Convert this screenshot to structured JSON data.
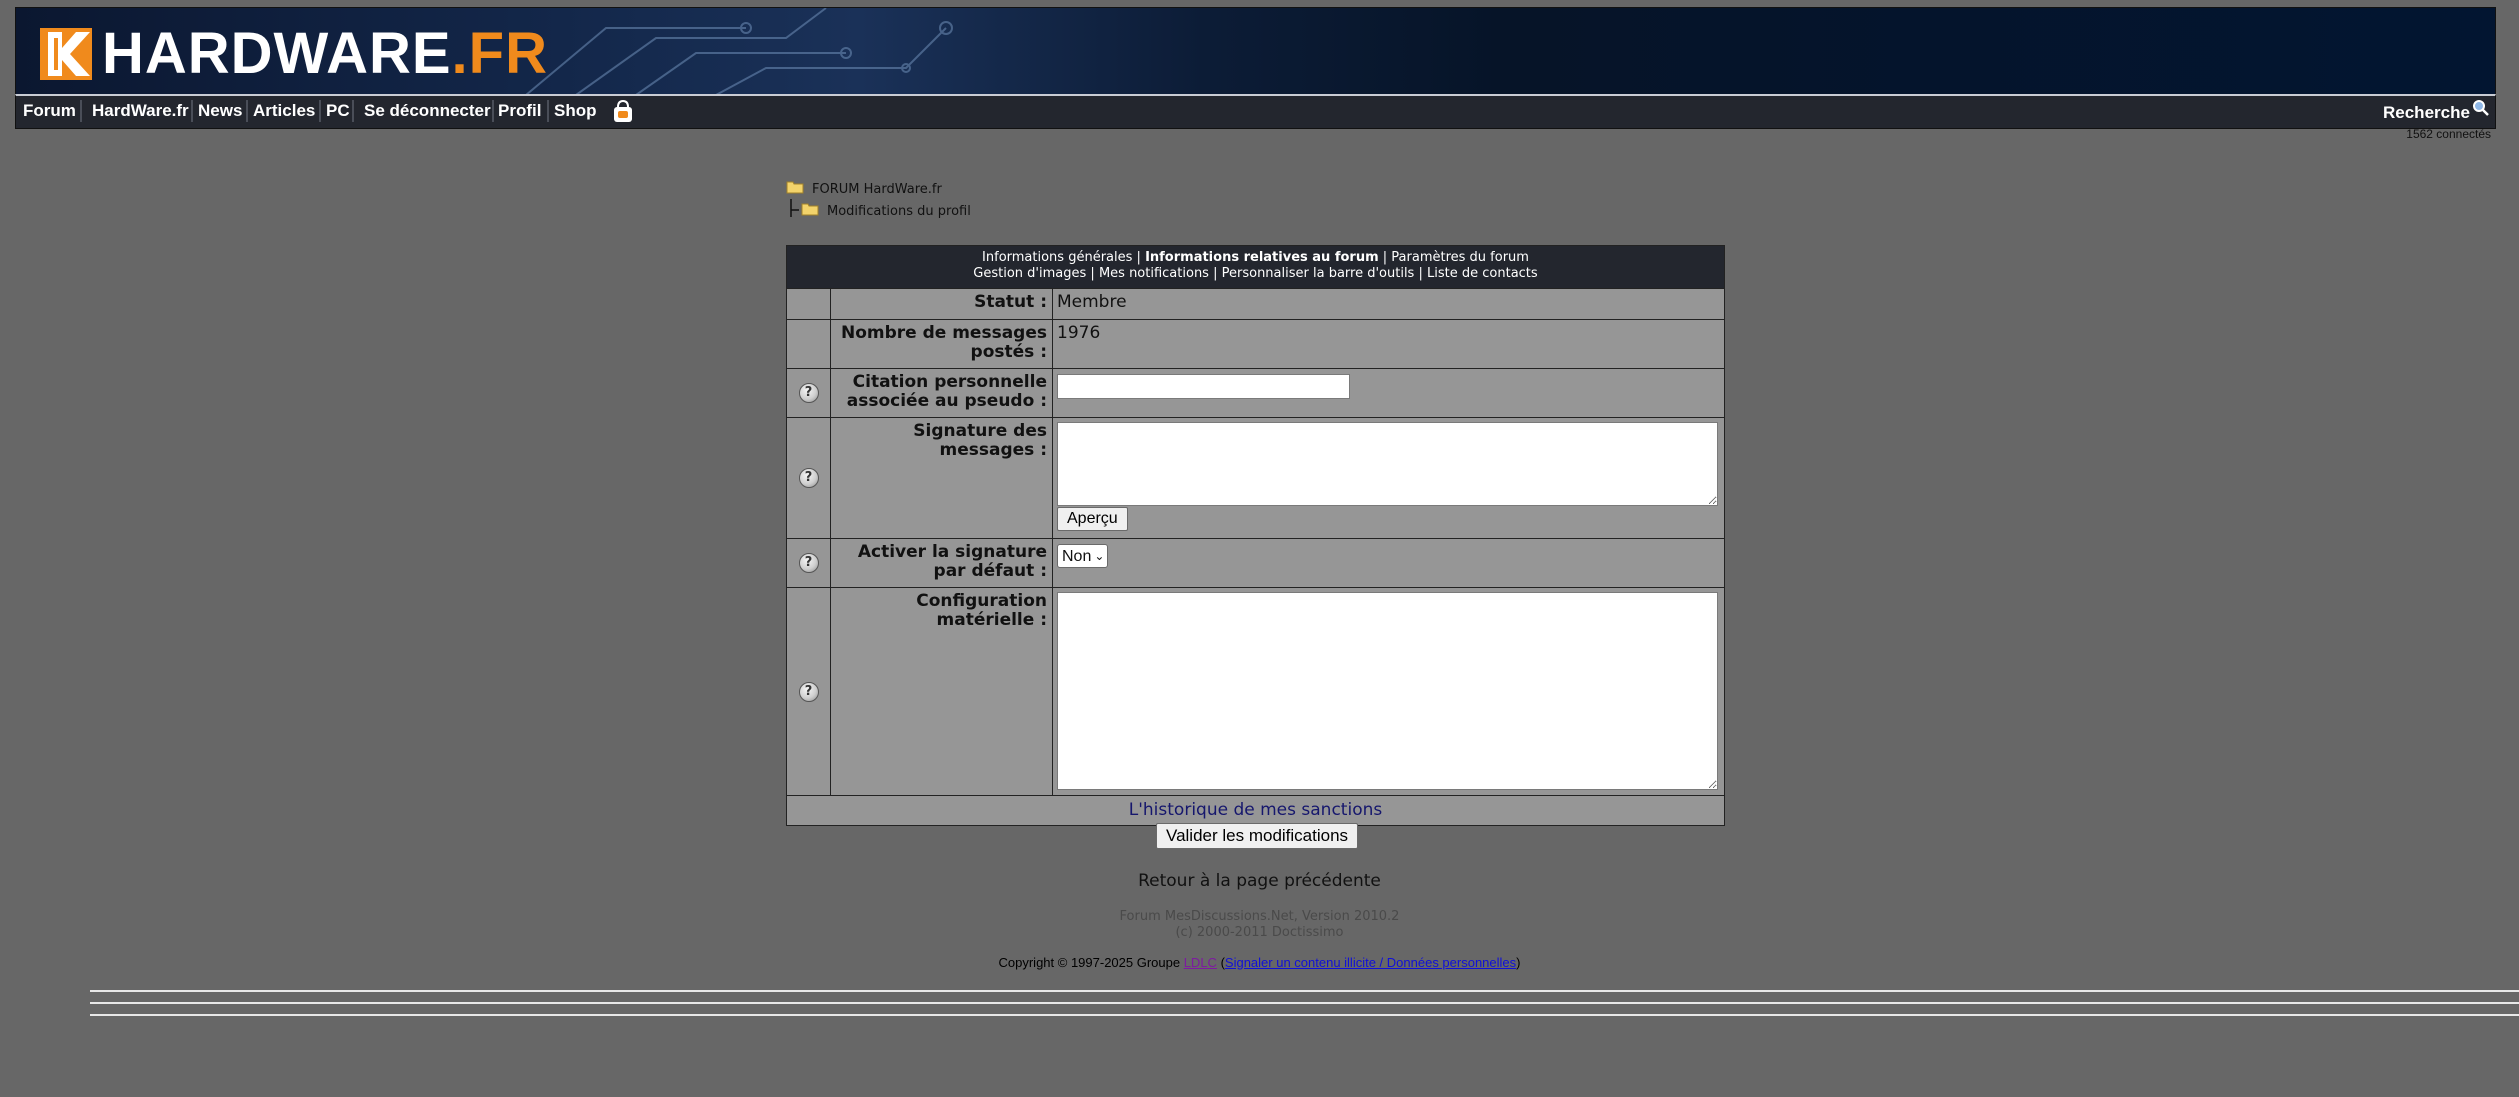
{
  "header": {
    "logo_text": "HARDWARE",
    "logo_suffix": ".FR",
    "brand_color": "#f08a1c"
  },
  "nav": {
    "items": [
      "Forum",
      "HardWare.fr",
      "News",
      "Articles",
      "PC",
      "Se déconnecter",
      "Profil",
      "Shop"
    ],
    "search_label": "Recherche",
    "connected": "1562 connectés"
  },
  "breadcrumb": {
    "root": "FORUM HardWare.fr",
    "current": "Modifications du profil"
  },
  "tabs": {
    "line1": [
      "Informations générales",
      "Informations relatives au forum",
      "Paramètres du forum"
    ],
    "line2": [
      "Gestion d'images",
      "Mes notifications",
      "Personnaliser la barre d'outils",
      "Liste de contacts"
    ],
    "separator": "|"
  },
  "form": {
    "statut_label": "Statut :",
    "statut_value": "Membre",
    "messages_label": "Nombre de messages postés :",
    "messages_value": "1976",
    "citation_label": "Citation personnelle associée au pseudo :",
    "citation_value": "",
    "signature_label": "Signature des messages :",
    "signature_value": "",
    "apercu_label": "Aperçu",
    "activer_label": "Activer la signature par défaut :",
    "activer_value": "Non",
    "config_label": "Configuration matérielle :",
    "config_value": "",
    "help_glyph": "?",
    "sanctions_link": "L'historique de mes sanctions"
  },
  "actions": {
    "submit_label": "Valider les modifications",
    "back_label": "Retour à la page précédente"
  },
  "footer": {
    "version": "Forum MesDiscussions.Net, Version 2010.2",
    "copyright_doc": "(c) 2000-2011 Doctissimo",
    "copyright_prefix": "Copyright © 1997-2025 Groupe ",
    "ldlc": "LDLC",
    "open_paren": " (",
    "report_link": "Signaler un contenu illicite / Données personnelles",
    "close_paren": ")"
  }
}
